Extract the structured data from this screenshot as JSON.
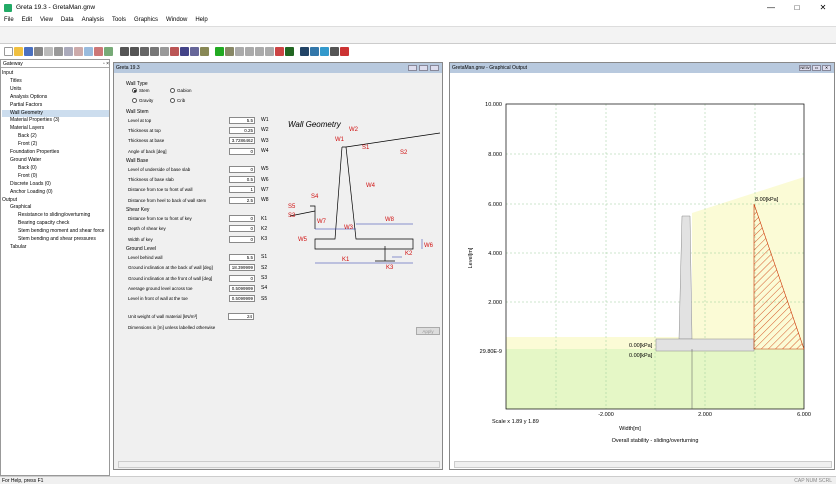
{
  "window": {
    "title": "Greta 19.3 - GretaMan.gnw",
    "minimize": "—",
    "maximize": "□",
    "close": "✕"
  },
  "menu": [
    "File",
    "Edit",
    "View",
    "Data",
    "Analysis",
    "Tools",
    "Graphics",
    "Window",
    "Help"
  ],
  "gateway": {
    "title": "Gateway",
    "pin": "▫ ×",
    "tree": [
      {
        "label": "Input",
        "level": 0
      },
      {
        "label": "Titles",
        "level": 1
      },
      {
        "label": "Units",
        "level": 1
      },
      {
        "label": "Analysis Options",
        "level": 1
      },
      {
        "label": "Partial Factors",
        "level": 1
      },
      {
        "label": "Wall Geometry",
        "level": 1
      },
      {
        "label": "Material Properties (3)",
        "level": 1
      },
      {
        "label": "Material Layers",
        "level": 1
      },
      {
        "label": "Back (2)",
        "level": 2
      },
      {
        "label": "Front (2)",
        "level": 2
      },
      {
        "label": "Foundation Properties",
        "level": 1
      },
      {
        "label": "Ground Water",
        "level": 1
      },
      {
        "label": "Back (0)",
        "level": 2
      },
      {
        "label": "Front (0)",
        "level": 2
      },
      {
        "label": "Discrete Loads (0)",
        "level": 1
      },
      {
        "label": "Anchor Loading (0)",
        "level": 1
      },
      {
        "label": "Output",
        "level": 0
      },
      {
        "label": "Graphical",
        "level": 1
      },
      {
        "label": "Resistance to sliding/overturning",
        "level": 2
      },
      {
        "label": "Bearing capacity check",
        "level": 2
      },
      {
        "label": "Stem bending moment and shear force",
        "level": 2
      },
      {
        "label": "Stem bending and shear pressures",
        "level": 2
      },
      {
        "label": "Tabular",
        "level": 1
      }
    ]
  },
  "input_window": {
    "title": "Greta 19.3",
    "wall_type": {
      "heading": "Wall Type",
      "options": [
        "Stem",
        "Gabion",
        "Gravity",
        "Crib"
      ],
      "selected": "Stem"
    },
    "wall_stem": {
      "heading": "Wall Stem",
      "rows": [
        {
          "label": "Level at top",
          "value": "5.5",
          "code": "W1"
        },
        {
          "label": "Thickness at top",
          "value": "0.25",
          "code": "W2"
        },
        {
          "label": "Thickness at base",
          "value": "3.7286462",
          "code": "W3"
        },
        {
          "label": "Angle of back [deg]",
          "value": "0",
          "code": "W4"
        }
      ]
    },
    "wall_base": {
      "heading": "Wall Base",
      "rows": [
        {
          "label": "Level of underside of base slab",
          "value": "0",
          "code": "W5"
        },
        {
          "label": "Thickness of base slab",
          "value": "0.5",
          "code": "W6"
        },
        {
          "label": "Distance from toe to front of wall",
          "value": "1",
          "code": "W7"
        },
        {
          "label": "Distance from heel to back of wall stem",
          "value": "2.5",
          "code": "W8"
        }
      ]
    },
    "shear_key": {
      "heading": "Shear Key",
      "rows": [
        {
          "label": "Distance from toe to front of key",
          "value": "0",
          "code": "K1"
        },
        {
          "label": "Depth of shear key",
          "value": "0",
          "code": "K2"
        },
        {
          "label": "Width of key",
          "value": "0",
          "code": "K3"
        }
      ]
    },
    "ground_level": {
      "heading": "Ground Level",
      "rows": [
        {
          "label": "Level behind wall",
          "value": "5.5",
          "code": "S1"
        },
        {
          "label": "Ground inclination at the back of wall [deg]",
          "value": "18.399999",
          "code": "S2"
        },
        {
          "label": "Ground inclination at the front of wall [deg]",
          "value": "0",
          "code": "S3"
        },
        {
          "label": "Average ground level across toe",
          "value": "0.5099999",
          "code": "S4"
        },
        {
          "label": "Level in front of wall at the toe",
          "value": "0.5099999",
          "code": "S5"
        }
      ]
    },
    "unit_weight": {
      "label": "Unit weight of wall material [kN/m³]",
      "value": "24"
    },
    "dimensions_note": "Dimensions in [m] unless labelled otherwise",
    "apply": "Apply",
    "diagram": {
      "title": "Wall Geometry",
      "labels": [
        "W1",
        "W2",
        "S1",
        "S2",
        "W4",
        "S4",
        "S5",
        "S3",
        "W7",
        "W3",
        "W8",
        "W5",
        "W6",
        "K1",
        "K2",
        "K3"
      ]
    }
  },
  "graph_window": {
    "title": "GretaMan.gnw - Graphical Output",
    "buttons": [
      "NEW",
      "▭",
      "✕"
    ],
    "ylabel": "Level[m]",
    "xlabel": "Width[m]",
    "y_ticks": [
      "10.000",
      "8.000",
      "6.000",
      "4.000",
      "2.000",
      "29.80E-9"
    ],
    "x_ticks": [
      "-2.000",
      "2.000",
      "6.000"
    ],
    "pressure_labels": [
      "8.00[kPa]",
      "0.00[kPa]",
      "0.00[kPa]"
    ],
    "scale": "Scale x 1.89  y 1.89",
    "caption": "Overall stability - sliding/overturning"
  },
  "status": {
    "left": "For Help, press F1",
    "right": "CAP NUM SCRL"
  },
  "colors": {
    "backfill": "#fbfbd6",
    "front_soil": "#e5f7c6",
    "wedge": "#cc3300",
    "wall": "#e2e2e2",
    "window_header": "#b8c9de"
  }
}
